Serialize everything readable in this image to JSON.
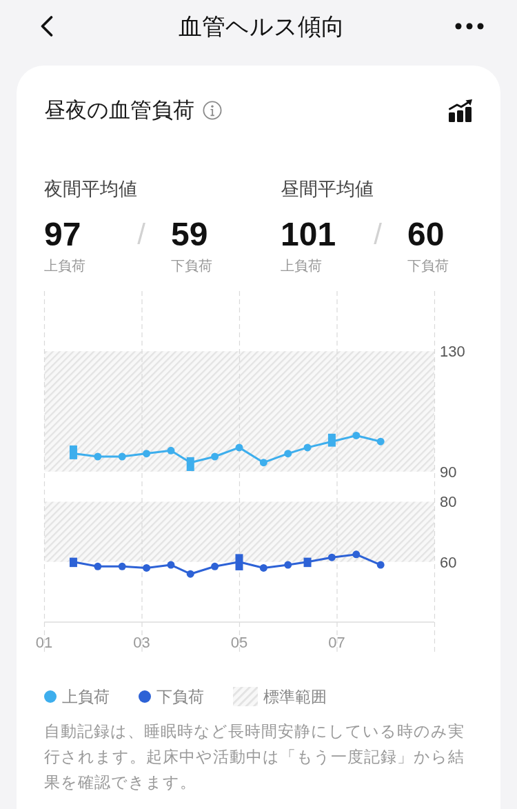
{
  "header": {
    "title": "血管ヘルス傾向"
  },
  "card": {
    "title": "昼夜の血管負荷",
    "averages": [
      {
        "label": "夜間平均値",
        "separator": "/",
        "values": [
          {
            "value": "97",
            "caption": "上負荷"
          },
          {
            "value": "59",
            "caption": "下負荷"
          }
        ]
      },
      {
        "label": "昼間平均値",
        "separator": "/",
        "values": [
          {
            "value": "101",
            "caption": "上負荷"
          },
          {
            "value": "60",
            "caption": "下負荷"
          }
        ]
      }
    ],
    "chart_data": {
      "type": "line",
      "grid": true,
      "x": [
        1.6,
        2.1,
        2.6,
        3.1,
        3.6,
        4.0,
        4.5,
        5.0,
        5.5,
        6.0,
        6.4,
        6.9,
        7.4,
        7.9
      ],
      "xlim": [
        1,
        9
      ],
      "ylim": [
        40,
        150
      ],
      "xticks": [
        {
          "value": 1,
          "label": "01"
        },
        {
          "value": 3,
          "label": "03"
        },
        {
          "value": 5,
          "label": "05"
        },
        {
          "value": 7,
          "label": "07"
        }
      ],
      "yticks": [
        130,
        90,
        80,
        60
      ],
      "series": [
        {
          "name": "上負荷",
          "color": "#3daeed",
          "marker": "circle",
          "values": [
            96,
            95,
            95,
            96,
            97,
            93,
            95,
            98,
            93,
            96,
            98,
            100,
            102,
            100
          ],
          "errors": [
            [
              94.1,
              98.7
            ],
            null,
            null,
            null,
            null,
            [
              90.2,
              94.8
            ],
            null,
            null,
            null,
            null,
            null,
            [
              98.3,
              102.6
            ],
            null,
            null
          ]
        },
        {
          "name": "下負荷",
          "color": "#2d62d6",
          "marker": "circle",
          "values": [
            60,
            58.5,
            58.5,
            58,
            59,
            56,
            58.5,
            60,
            58,
            59,
            60,
            61.5,
            62.5,
            59
          ],
          "errors": [
            [
              58.3,
              61.4
            ],
            null,
            null,
            null,
            null,
            null,
            null,
            [
              57.2,
              62.6
            ],
            null,
            null,
            [
              58.3,
              61.4
            ],
            null,
            null,
            null
          ]
        }
      ],
      "bands": [
        {
          "axis": "y",
          "from": 90,
          "to": 130,
          "label": "標準範囲"
        },
        {
          "axis": "y",
          "from": 60,
          "to": 80
        }
      ]
    },
    "note": "自動記録は、睡眠時など長時間安静にしている時のみ実行されます。起床中や活動中は「もう一度記録」から結果を確認できます。"
  }
}
